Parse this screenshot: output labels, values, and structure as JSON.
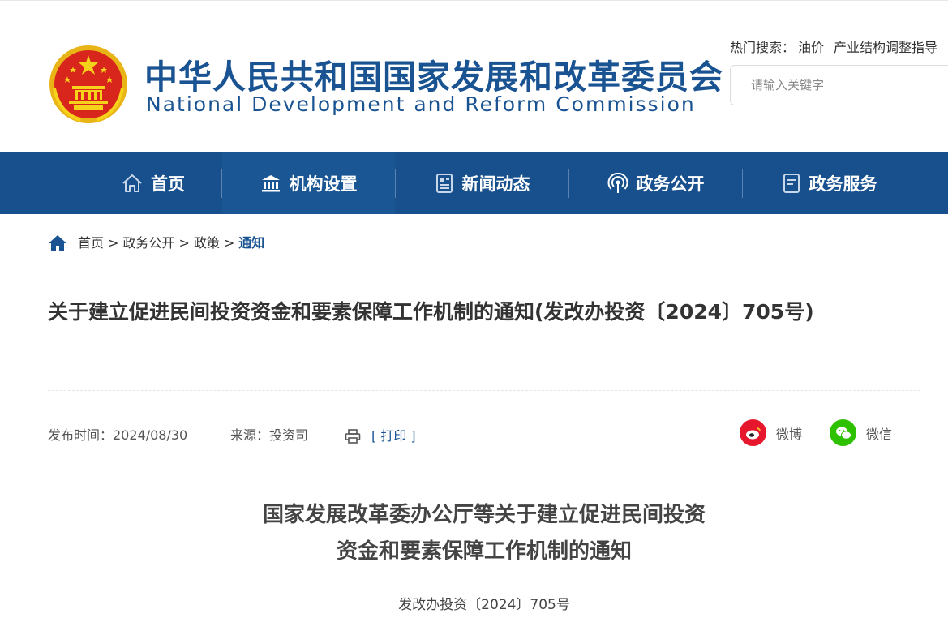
{
  "header": {
    "title_cn": "中华人民共和国国家发展和改革委员会",
    "title_en": "National Development and Reform Commission",
    "hot_search_label": "热门搜索：",
    "hot_keywords": [
      "油价",
      "产业结构调整指导"
    ],
    "search_placeholder": "请输入关键字"
  },
  "nav": {
    "items": [
      {
        "label": "首页",
        "icon": "home-icon"
      },
      {
        "label": "机构设置",
        "icon": "building-icon"
      },
      {
        "label": "新闻动态",
        "icon": "news-icon"
      },
      {
        "label": "政务公开",
        "icon": "broadcast-icon"
      },
      {
        "label": "政务服务",
        "icon": "service-icon"
      }
    ],
    "active_index": 1
  },
  "breadcrumb": {
    "items": [
      "首页",
      "政务公开",
      "政策",
      "通知"
    ],
    "separator": ">"
  },
  "article": {
    "title": "关于建立促进民间投资资金和要素保障工作机制的通知(发改办投资〔2024〕705号)",
    "publish_label": "发布时间：2024/08/30",
    "source_label": "来源：投资司",
    "print_label": "[ 打印 ]",
    "share": {
      "weibo": "微博",
      "wechat": "微信"
    },
    "doc_title_line1": "国家发展改革委办公厅等关于建立促进民间投资",
    "doc_title_line2": "资金和要素保障工作机制的通知",
    "doc_number": "发改办投资〔2024〕705号"
  },
  "colors": {
    "brand_blue": "#1a5392",
    "nav_bg": "#17508d",
    "weibo_red": "#e6162d",
    "wechat_green": "#2dc100"
  }
}
